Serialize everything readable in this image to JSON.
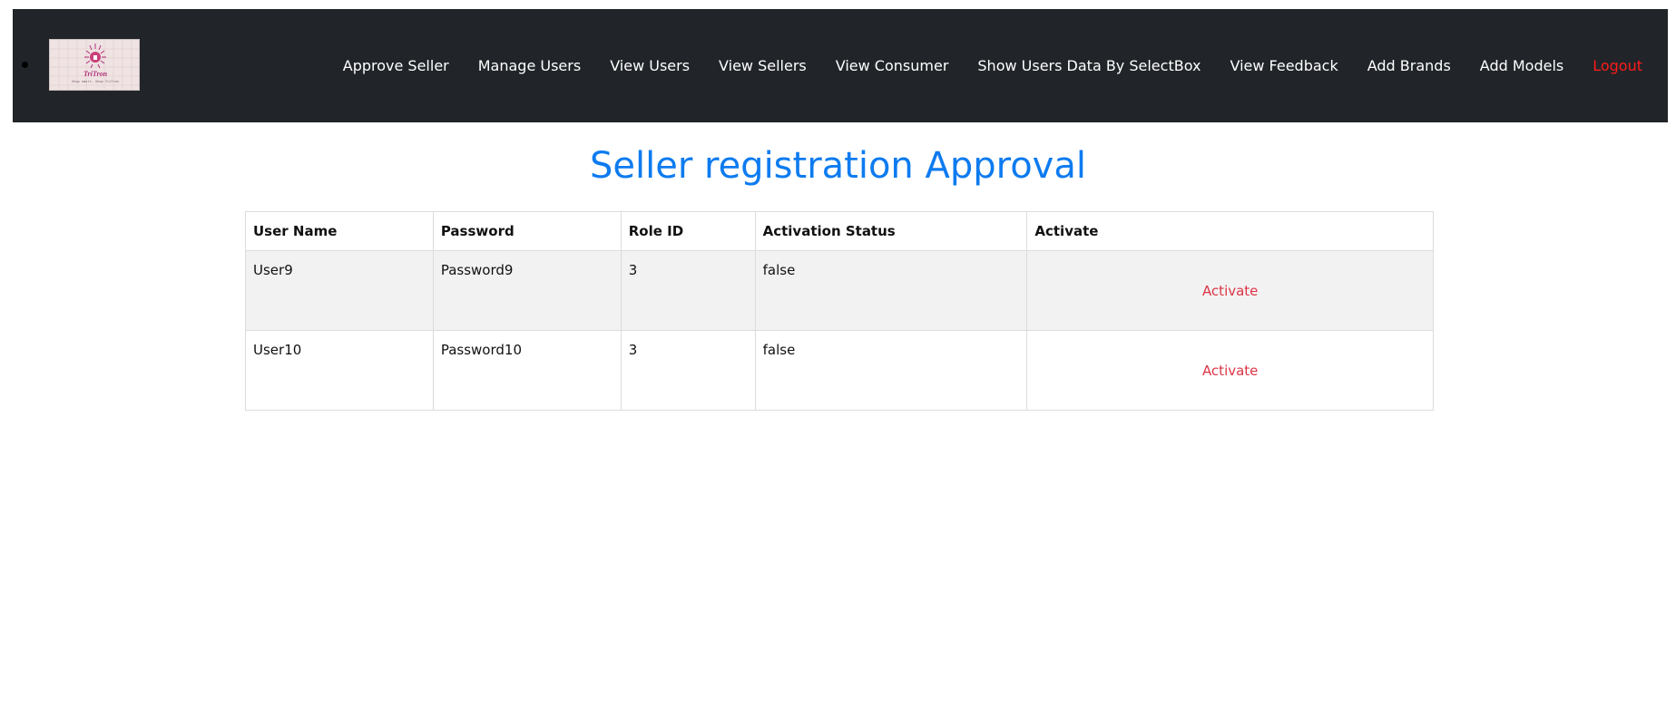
{
  "nav": {
    "items": [
      {
        "label": "Approve Seller"
      },
      {
        "label": "Manage Users"
      },
      {
        "label": "View Users"
      },
      {
        "label": "View Sellers"
      },
      {
        "label": "View Consumer"
      },
      {
        "label": "Show Users Data By SelectBox"
      },
      {
        "label": "View Feedback"
      },
      {
        "label": "Add Brands"
      },
      {
        "label": "Add Models"
      }
    ],
    "logout_label": "Logout",
    "logout_color": "#ff1a1a",
    "background": "#212529"
  },
  "logo": {
    "text": "TriTron",
    "tagline": "Shop smart. Shop TriTron"
  },
  "page": {
    "title": "Seller registration Approval",
    "title_color": "#0d7bf0"
  },
  "table": {
    "headers": [
      "User Name",
      "Password",
      "Role ID",
      "Activation Status",
      "Activate"
    ],
    "rows": [
      {
        "user_name": "User9",
        "password": "Password9",
        "role_id": "3",
        "activation_status": "false",
        "action": "Activate"
      },
      {
        "user_name": "User10",
        "password": "Password10",
        "role_id": "3",
        "activation_status": "false",
        "action": "Activate"
      }
    ],
    "action_color": "#dc3545"
  }
}
